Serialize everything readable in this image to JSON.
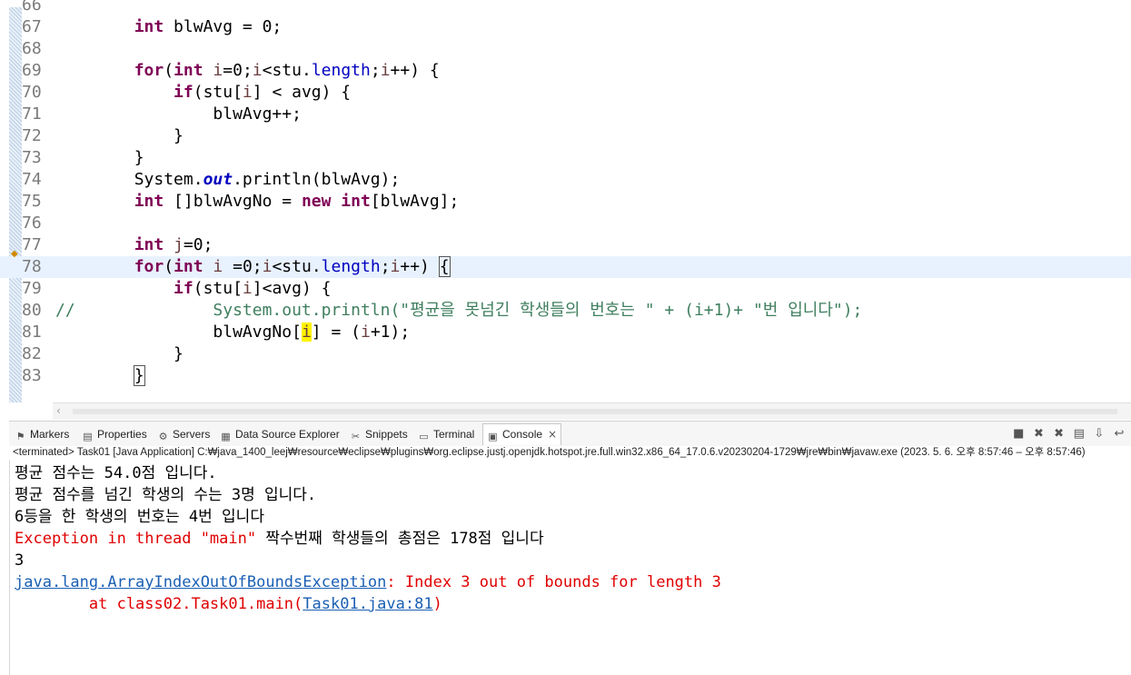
{
  "editor": {
    "lines": [
      {
        "n": "66",
        "html": ""
      },
      {
        "n": "67",
        "html": "        <span class=\"kw\">int</span> blwAvg = 0;"
      },
      {
        "n": "68",
        "html": ""
      },
      {
        "n": "69",
        "html": "        <span class=\"kw\">for</span>(<span class=\"kw\">int</span> <span class=\"var\">i</span>=0;<span class=\"var\">i</span>&lt;stu.<span class=\"prop\">length</span>;<span class=\"var\">i</span>++) {"
      },
      {
        "n": "70",
        "html": "            <span class=\"kw\">if</span>(stu[<span class=\"var\">i</span>] &lt; avg) {"
      },
      {
        "n": "71",
        "html": "                blwAvg++;"
      },
      {
        "n": "72",
        "html": "            }"
      },
      {
        "n": "73",
        "html": "        }"
      },
      {
        "n": "74",
        "html": "        System.<span class=\"fld\">out</span>.println(blwAvg);"
      },
      {
        "n": "75",
        "html": "        <span class=\"kw\">int</span> []blwAvgNo = <span class=\"kw\">new</span> <span class=\"kw\">int</span>[blwAvg];"
      },
      {
        "n": "76",
        "html": ""
      },
      {
        "n": "77",
        "html": "        <span class=\"kw\">int</span> <span class=\"var\">j</span>=0;"
      },
      {
        "n": "78",
        "html": "        <span class=\"kw\">for</span>(<span class=\"kw\">int</span> <span class=\"var\">i</span> =0;<span class=\"var\">i</span>&lt;stu.<span class=\"prop\">length</span>;<span class=\"var\">i</span>++) <span class=\"caretbox\">{</span>"
      },
      {
        "n": "79",
        "html": "            <span class=\"kw\">if</span>(stu[<span class=\"var\">i</span>]&lt;avg) {"
      },
      {
        "n": "80",
        "html": "<span class=\"cmt\">//              System.out.println(\"평균을 못넘긴 학생들의 번호는 \" + (i+1)+ \"번 입니다\");</span>"
      },
      {
        "n": "81",
        "html": "                blwAvgNo[<span class=\"var hl\">i</span>] = (<span class=\"var\">i</span>+1);"
      },
      {
        "n": "82",
        "html": "            }"
      },
      {
        "n": "83",
        "html": "        <span class=\"caretbox\">}</span>"
      }
    ]
  },
  "tabs": {
    "markers": "Markers",
    "properties": "Properties",
    "servers": "Servers",
    "dse": "Data Source Explorer",
    "snippets": "Snippets",
    "terminal": "Terminal",
    "console": "Console"
  },
  "console": {
    "header": "<terminated> Task01 [Java Application] C:₩java_1400_leej₩resource₩eclipse₩plugins₩org.eclipse.justj.openjdk.hotspot.jre.full.win32.x86_64_17.0.6.v20230204-1729₩jre₩bin₩javaw.exe  (2023. 5. 6. 오후 8:57:46 – 오후 8:57:46)",
    "out1": "평균 점수는 54.0점 입니다.",
    "out2": "평균 점수를 넘긴 학생의 수는 3명 입니다.",
    "out3": "6등을 한 학생의 번호는 4번 입니다",
    "exc_prefix": "Exception in thread \"main\" ",
    "out4_rest": "짝수번째 학생들의 총점은 178점 입니다",
    "out5": "3",
    "exc_class": "java.lang.ArrayIndexOutOfBoundsException",
    "exc_msg": ": Index 3 out of bounds for length 3",
    "trace_prefix": "        at class02.Task01.main(",
    "trace_link": "Task01.java:81",
    "trace_suffix": ")"
  }
}
